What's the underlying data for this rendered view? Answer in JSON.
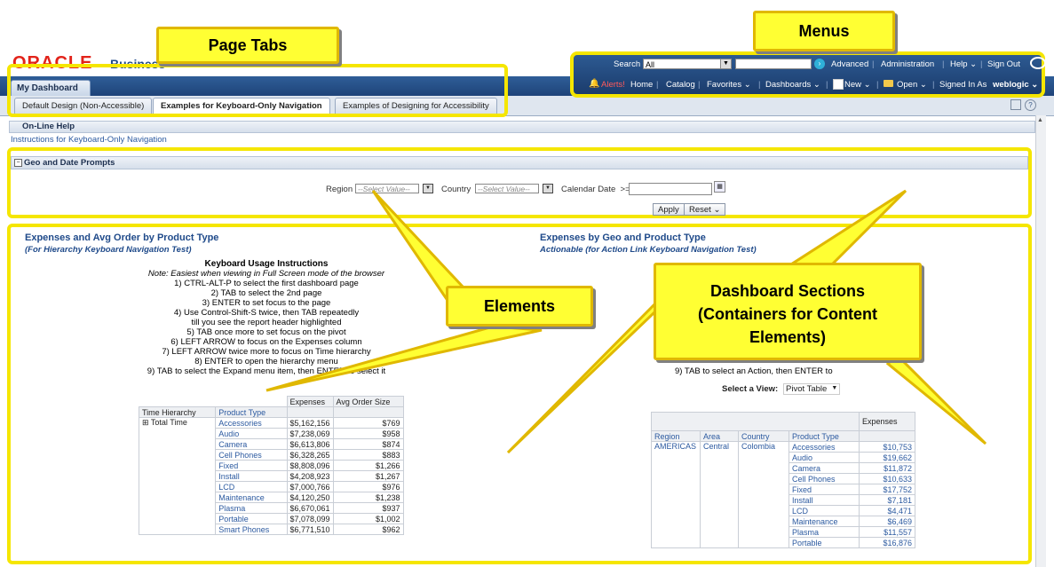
{
  "app": {
    "logo": "ORACLE",
    "product": "Business"
  },
  "dashboard": {
    "title": "My Dashboard",
    "tabs": [
      {
        "label": "Default Design (Non-Accessible)",
        "active": false
      },
      {
        "label": "Examples for Keyboard-Only Navigation",
        "active": true
      },
      {
        "label": "Examples of Designing for Accessibility",
        "active": false
      }
    ]
  },
  "menus": {
    "search_label": "Search",
    "search_scope": "All",
    "advanced": "Advanced",
    "administration": "Administration",
    "help": "Help ⌄",
    "sign_out": "Sign Out",
    "alerts": "Alerts!",
    "home": "Home",
    "catalog": "Catalog",
    "favorites": "Favorites ⌄",
    "dashboards": "Dashboards ⌄",
    "new": "New ⌄",
    "open": "Open ⌄",
    "signed_in_as": "Signed In As",
    "user": "weblogic ⌄"
  },
  "sections": {
    "online_help": {
      "title": "On-Line Help",
      "link": "Instructions for Keyboard-Only Navigation"
    },
    "prompts": {
      "title": "Geo and Date Prompts",
      "region_label": "Region",
      "region_placeholder": "--Select Value--",
      "country_label": "Country",
      "country_placeholder": "--Select Value--",
      "date_label": "Calendar Date  >=",
      "apply": "Apply",
      "reset": "Reset ⌄"
    }
  },
  "report_left": {
    "title": "Expenses and Avg Order by Product Type",
    "subtitle": "(For Hierarchy Keyboard Navigation Test)",
    "instructions_title": "Keyboard Usage Instructions",
    "instructions": [
      "Note: Easiest when viewing in Full Screen mode of the browser",
      "1) CTRL-ALT-P to select the first dashboard page",
      "2) TAB to select the 2nd page",
      "3) ENTER to set focus to the page",
      "4) Use Control-Shift-S twice, then TAB repeatedly",
      "till you see the report header highlighted",
      "5) TAB once more to set focus on the pivot",
      "6) LEFT ARROW to focus on the Expenses column",
      "7) LEFT ARROW twice more to focus on Time hierarchy",
      "8) ENTER to open the hierarchy menu",
      "9) TAB to select the Expand menu item, then ENTER to select it"
    ],
    "table": {
      "col_expenses": "Expenses",
      "col_avg": "Avg Order Size",
      "row_hdr_time": "Time Hierarchy",
      "row_hdr_product": "Product Type",
      "time_value": "Total Time",
      "rows": [
        [
          "Accessories",
          "$5,162,156",
          "$769"
        ],
        [
          "Audio",
          "$7,238,069",
          "$958"
        ],
        [
          "Camera",
          "$6,613,806",
          "$874"
        ],
        [
          "Cell Phones",
          "$6,328,265",
          "$883"
        ],
        [
          "Fixed",
          "$8,808,096",
          "$1,266"
        ],
        [
          "Install",
          "$4,208,923",
          "$1,267"
        ],
        [
          "LCD",
          "$7,000,766",
          "$976"
        ],
        [
          "Maintenance",
          "$4,120,250",
          "$1,238"
        ],
        [
          "Plasma",
          "$6,670,061",
          "$937"
        ],
        [
          "Portable",
          "$7,078,099",
          "$1,002"
        ],
        [
          "Smart Phones",
          "$6,771,510",
          "$962"
        ]
      ]
    }
  },
  "report_right": {
    "title": "Expenses by Geo and Product Type",
    "subtitle": "Actionable (for Action Link Keyboard Navigation Test)",
    "instr_partial": "9) TAB to select an Action, then ENTER to",
    "select_view_label": "Select a View:",
    "select_view_value": "Pivot Table",
    "table": {
      "col_region": "Region",
      "col_area": "Area",
      "col_country": "Country",
      "col_product": "Product Type",
      "col_expenses": "Expenses",
      "region": "AMERICAS",
      "area": "Central",
      "country": "Colombia",
      "rows": [
        [
          "Accessories",
          "$10,753"
        ],
        [
          "Audio",
          "$19,662"
        ],
        [
          "Camera",
          "$11,872"
        ],
        [
          "Cell Phones",
          "$10,633"
        ],
        [
          "Fixed",
          "$17,752"
        ],
        [
          "Install",
          "$7,181"
        ],
        [
          "LCD",
          "$4,471"
        ],
        [
          "Maintenance",
          "$6,469"
        ],
        [
          "Plasma",
          "$11,557"
        ],
        [
          "Portable",
          "$16,876"
        ]
      ]
    }
  },
  "callouts": {
    "page_tabs": "Page Tabs",
    "menus": "Menus",
    "elements": "Elements",
    "sections": "Dashboard Sections (Containers for Content Elements)"
  },
  "colors": {
    "callout_yellow": "#ffff33",
    "frame_yellow": "#f5e600",
    "header_blue": "#1d4176",
    "link_blue": "#2c5aa0"
  }
}
